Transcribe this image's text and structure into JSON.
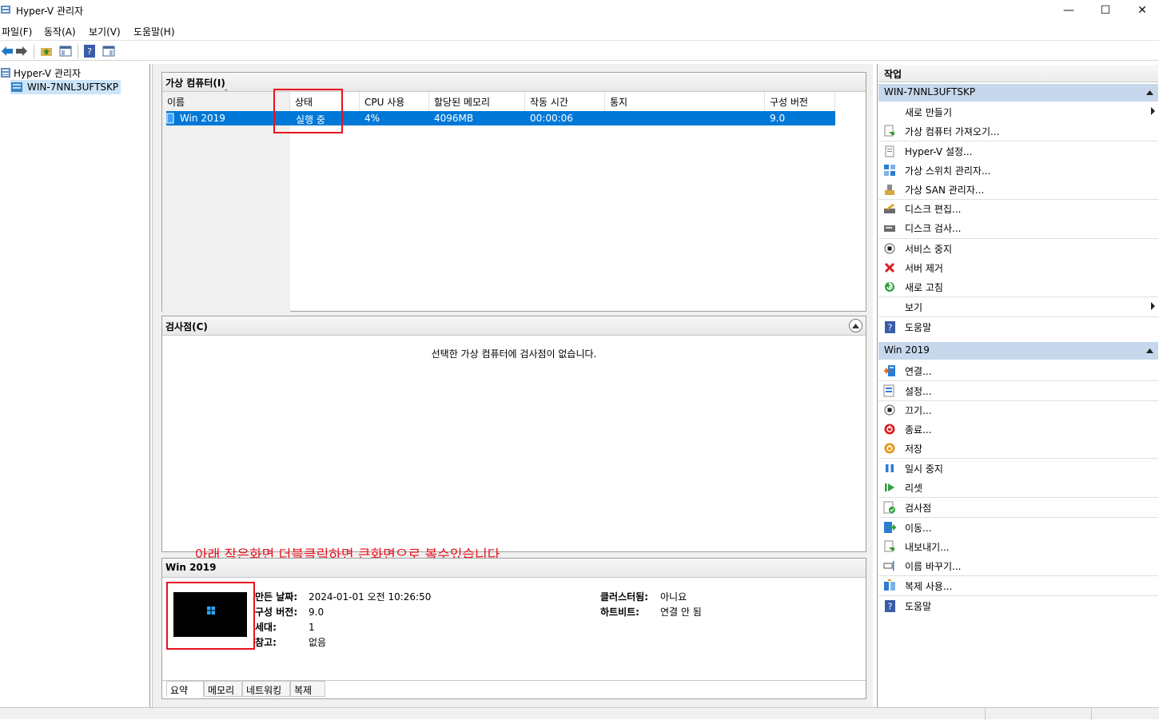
{
  "window": {
    "title": "Hyper-V 관리자",
    "minimize": "—",
    "maximize": "☐",
    "close": "✕"
  },
  "menu": [
    "파일(F)",
    "동작(A)",
    "보기(V)",
    "도움말(H)"
  ],
  "tree": {
    "root": "Hyper-V 관리자",
    "server": "WIN-7NNL3UFTSKP"
  },
  "vm_panel": {
    "title": "가상 컴퓨터(I)",
    "columns": [
      "이름",
      "상태",
      "CPU 사용",
      "할당된 메모리",
      "작동 시간",
      "통지",
      "구성 버전"
    ],
    "rows": [
      {
        "name": "Win 2019",
        "state": "실행 중",
        "cpu": "4%",
        "memory": "4096MB",
        "uptime": "00:00:06",
        "notice": "",
        "version": "9.0"
      }
    ]
  },
  "checkpoint_panel": {
    "title": "검사점(C)",
    "empty_message": "선택한 가상 컴퓨터에 검사점이 없습니다."
  },
  "annotation": "아래 작은화면 더블클릭하면 큰화면으로 볼수있습니다",
  "details": {
    "title": "Win 2019",
    "left": [
      {
        "label": "만든 날짜:",
        "value": "2024-01-01 오전 10:26:50"
      },
      {
        "label": "구성 버전:",
        "value": "9.0"
      },
      {
        "label": "세대:",
        "value": "1"
      },
      {
        "label": "참고:",
        "value": "없음"
      }
    ],
    "right": [
      {
        "label": "클러스터됨:",
        "value": "아니요"
      },
      {
        "label": "하트비트:",
        "value": "연결 안 됨"
      }
    ],
    "tabs": [
      "요약",
      "메모리",
      "네트워킹",
      "복제"
    ]
  },
  "actions": {
    "header": "작업",
    "server_section": {
      "title": "WIN-7NNL3UFTSKP",
      "items": [
        {
          "label": "새로 만들기",
          "icon": "none",
          "submenu": true
        },
        {
          "label": "가상 컴퓨터 가져오기...",
          "icon": "import-icon"
        },
        {
          "label": "Hyper-V 설정...",
          "icon": "settings-page-icon"
        },
        {
          "label": "가상 스위치 관리자...",
          "icon": "switch-icon"
        },
        {
          "label": "가상 SAN 관리자...",
          "icon": "san-icon"
        },
        {
          "label": "디스크 편집...",
          "icon": "disk-edit-icon"
        },
        {
          "label": "디스크 검사...",
          "icon": "disk-inspect-icon"
        },
        {
          "label": "서비스 중지",
          "icon": "stop-icon"
        },
        {
          "label": "서버 제거",
          "icon": "remove-icon"
        },
        {
          "label": "새로 고침",
          "icon": "refresh-icon"
        },
        {
          "label": "보기",
          "icon": "none",
          "submenu": true
        },
        {
          "label": "도움말",
          "icon": "help-icon"
        }
      ]
    },
    "vm_section": {
      "title": "Win 2019",
      "items": [
        {
          "label": "연결...",
          "icon": "connect-icon"
        },
        {
          "label": "설정...",
          "icon": "settings-icon"
        },
        {
          "label": "끄기...",
          "icon": "turn-off-icon"
        },
        {
          "label": "종료...",
          "icon": "shutdown-icon"
        },
        {
          "label": "저장",
          "icon": "save-icon"
        },
        {
          "label": "일시 중지",
          "icon": "pause-icon"
        },
        {
          "label": "리셋",
          "icon": "reset-icon"
        },
        {
          "label": "검사점",
          "icon": "checkpoint-icon"
        },
        {
          "label": "이동...",
          "icon": "move-icon"
        },
        {
          "label": "내보내기...",
          "icon": "export-icon"
        },
        {
          "label": "이름 바꾸기...",
          "icon": "rename-icon"
        },
        {
          "label": "복제 사용...",
          "icon": "replication-icon"
        },
        {
          "label": "도움말",
          "icon": "help-icon"
        }
      ]
    }
  },
  "colors": {
    "selection": "#0078d7",
    "section_header": "#c7d8ec",
    "annotation_red": "#e8121c"
  }
}
